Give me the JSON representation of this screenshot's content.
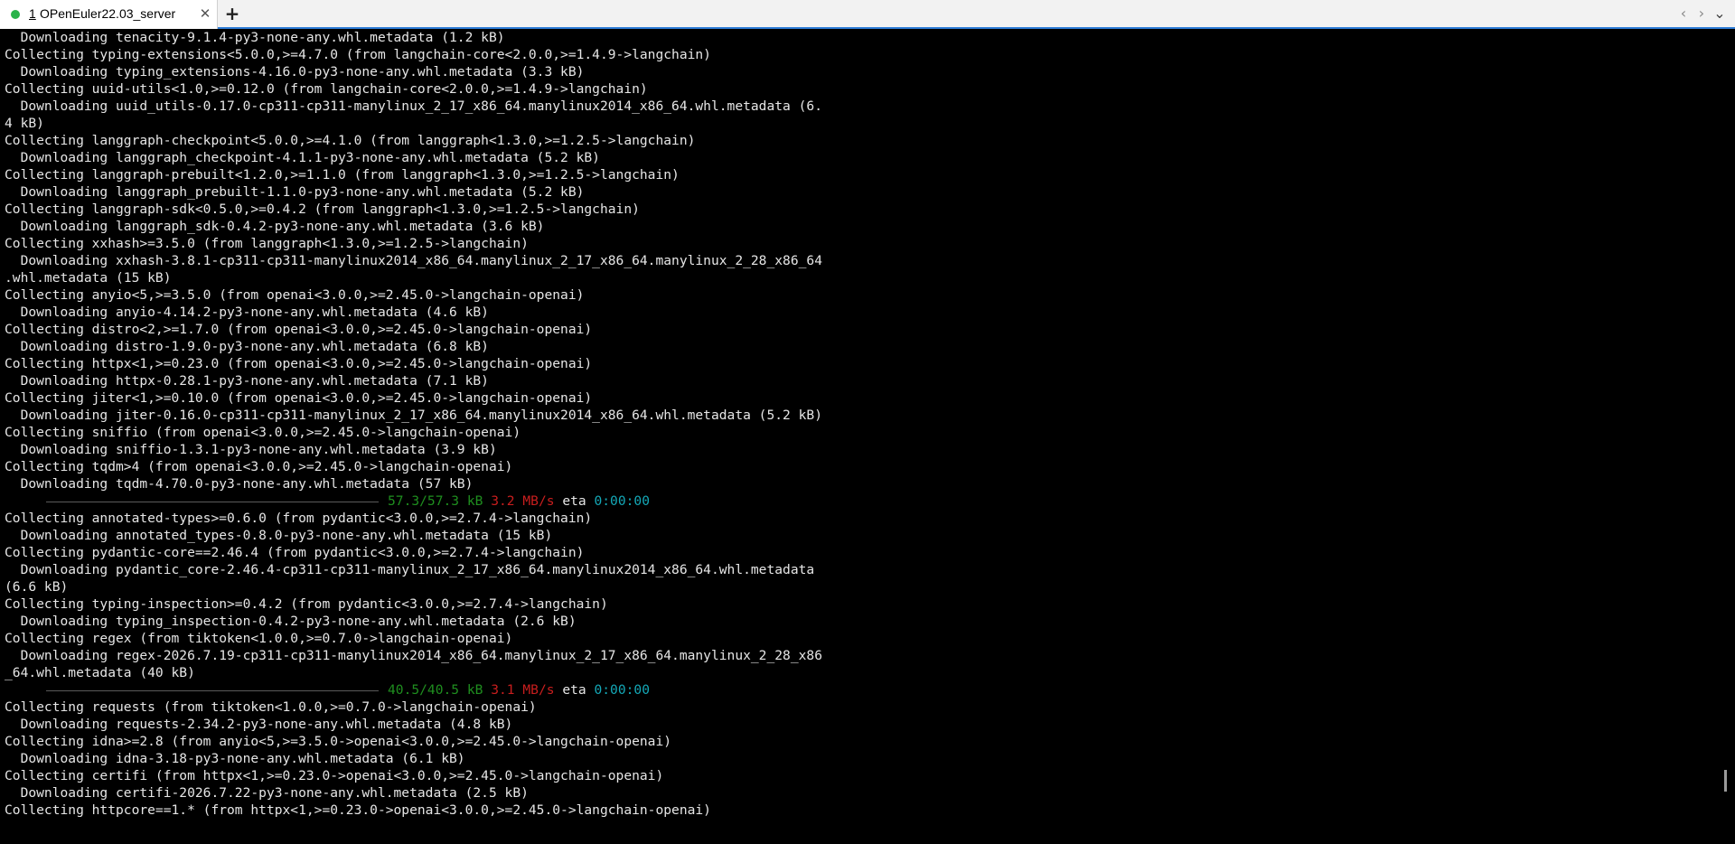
{
  "window": {
    "tab": {
      "number": "1",
      "title": "OPenEuler22.03_server",
      "close_symbol": "✕",
      "status_color": "#2ab34a"
    },
    "new_tab_symbol": "+",
    "nav": {
      "prev": "‹",
      "next": "›",
      "menu": "⌄"
    }
  },
  "terminal": {
    "lines": [
      "  Downloading tenacity-9.1.4-py3-none-any.whl.metadata (1.2 kB)",
      "Collecting typing-extensions<5.0.0,>=4.7.0 (from langchain-core<2.0.0,>=1.4.9->langchain)",
      "  Downloading typing_extensions-4.16.0-py3-none-any.whl.metadata (3.3 kB)",
      "Collecting uuid-utils<1.0,>=0.12.0 (from langchain-core<2.0.0,>=1.4.9->langchain)",
      "  Downloading uuid_utils-0.17.0-cp311-cp311-manylinux_2_17_x86_64.manylinux2014_x86_64.whl.metadata (6.",
      "4 kB)",
      "Collecting langgraph-checkpoint<5.0.0,>=4.1.0 (from langgraph<1.3.0,>=1.2.5->langchain)",
      "  Downloading langgraph_checkpoint-4.1.1-py3-none-any.whl.metadata (5.2 kB)",
      "Collecting langgraph-prebuilt<1.2.0,>=1.1.0 (from langgraph<1.3.0,>=1.2.5->langchain)",
      "  Downloading langgraph_prebuilt-1.1.0-py3-none-any.whl.metadata (5.2 kB)",
      "Collecting langgraph-sdk<0.5.0,>=0.4.2 (from langgraph<1.3.0,>=1.2.5->langchain)",
      "  Downloading langgraph_sdk-0.4.2-py3-none-any.whl.metadata (3.6 kB)",
      "Collecting xxhash>=3.5.0 (from langgraph<1.3.0,>=1.2.5->langchain)",
      "  Downloading xxhash-3.8.1-cp311-cp311-manylinux2014_x86_64.manylinux_2_17_x86_64.manylinux_2_28_x86_64",
      ".whl.metadata (15 kB)",
      "Collecting anyio<5,>=3.5.0 (from openai<3.0.0,>=2.45.0->langchain-openai)",
      "  Downloading anyio-4.14.2-py3-none-any.whl.metadata (4.6 kB)",
      "Collecting distro<2,>=1.7.0 (from openai<3.0.0,>=2.45.0->langchain-openai)",
      "  Downloading distro-1.9.0-py3-none-any.whl.metadata (6.8 kB)",
      "Collecting httpx<1,>=0.23.0 (from openai<3.0.0,>=2.45.0->langchain-openai)",
      "  Downloading httpx-0.28.1-py3-none-any.whl.metadata (7.1 kB)",
      "Collecting jiter<1,>=0.10.0 (from openai<3.0.0,>=2.45.0->langchain-openai)",
      "  Downloading jiter-0.16.0-cp311-cp311-manylinux_2_17_x86_64.manylinux2014_x86_64.whl.metadata (5.2 kB)",
      "Collecting sniffio (from openai<3.0.0,>=2.45.0->langchain-openai)",
      "  Downloading sniffio-1.3.1-py3-none-any.whl.metadata (3.9 kB)",
      "Collecting tqdm>4 (from openai<3.0.0,>=2.45.0->langchain-openai)",
      "  Downloading tqdm-4.70.0-py3-none-any.whl.metadata (57 kB)",
      {
        "progress": {
          "size": "57.3/57.3 kB",
          "speed": "3.2 MB/s",
          "eta_label": "eta",
          "eta": "0:00:00"
        }
      },
      "Collecting annotated-types>=0.6.0 (from pydantic<3.0.0,>=2.7.4->langchain)",
      "  Downloading annotated_types-0.8.0-py3-none-any.whl.metadata (15 kB)",
      "Collecting pydantic-core==2.46.4 (from pydantic<3.0.0,>=2.7.4->langchain)",
      "  Downloading pydantic_core-2.46.4-cp311-cp311-manylinux_2_17_x86_64.manylinux2014_x86_64.whl.metadata",
      "(6.6 kB)",
      "Collecting typing-inspection>=0.4.2 (from pydantic<3.0.0,>=2.7.4->langchain)",
      "  Downloading typing_inspection-0.4.2-py3-none-any.whl.metadata (2.6 kB)",
      "Collecting regex (from tiktoken<1.0.0,>=0.7.0->langchain-openai)",
      "  Downloading regex-2026.7.19-cp311-cp311-manylinux2014_x86_64.manylinux_2_17_x86_64.manylinux_2_28_x86",
      "_64.whl.metadata (40 kB)",
      {
        "progress": {
          "size": "40.5/40.5 kB",
          "speed": "3.1 MB/s",
          "eta_label": "eta",
          "eta": "0:00:00"
        }
      },
      "Collecting requests (from tiktoken<1.0.0,>=0.7.0->langchain-openai)",
      "  Downloading requests-2.34.2-py3-none-any.whl.metadata (4.8 kB)",
      "Collecting idna>=2.8 (from anyio<5,>=3.5.0->openai<3.0.0,>=2.45.0->langchain-openai)",
      "  Downloading idna-3.18-py3-none-any.whl.metadata (6.1 kB)",
      "Collecting certifi (from httpx<1,>=0.23.0->openai<3.0.0,>=2.45.0->langchain-openai)",
      "  Downloading certifi-2026.7.22-py3-none-any.whl.metadata (2.5 kB)",
      "Collecting httpcore==1.* (from httpx<1,>=0.23.0->openai<3.0.0,>=2.45.0->langchain-openai)"
    ],
    "colors": {
      "text": "#e6e6e6",
      "progress_size": "#1f8f1f",
      "progress_speed": "#c81e1e",
      "progress_eta": "#14a9b8"
    }
  }
}
